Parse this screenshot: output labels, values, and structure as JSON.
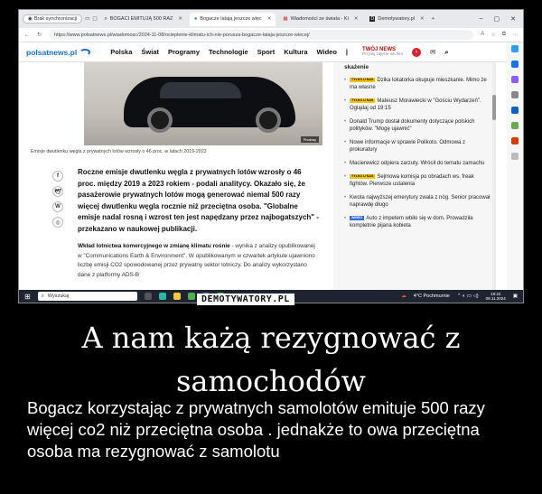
{
  "browser": {
    "sync_label": "Brak synchronizacji",
    "tabs": [
      {
        "label": "BOGACI EMITUJĄ 500 RAZ"
      },
      {
        "label": "Bogacze latają jeszcze więc"
      },
      {
        "label": "Wiadomości ze świata - Ki"
      },
      {
        "label": "Demotywatory.pl"
      }
    ],
    "url": "https://www.polsatnews.pl/wiadomosc/2024-11-08/ocieplenie-klimatu-ich-nie-porusza-bogacze-lataja-jeszcze-wiecej/"
  },
  "site": {
    "logo": "polsatnews.pl",
    "nav": [
      "Polska",
      "Świat",
      "Programy",
      "Technologie",
      "Sport",
      "Kultura",
      "Wideo"
    ],
    "twoj_label": "TWÓJ NEWS",
    "twoj_sub": "Przyślij zdjęcie lub film"
  },
  "article": {
    "photo_credit": "Pixabay",
    "caption": "Emisje dwutlenku węgla z prywatnych lotów wzrosły o 46 proc. w latach 2019-2023",
    "lead": "Roczne emisje dwutlenku węgla z prywatnych lotów wzrosły o 46 proc. między 2019 a 2023 rokiem - podali analitycy. Okazało się, że pasażerowie prywatnych lotów mogą generować niemal 500 razy więcej dwutlenku węgla rocznie niż przeciętna osoba. \"Globalne emisje nadal rosną i wzrost ten jest napędzany przez najbogatszych\" - przekazano w naukowej publikacji.",
    "body_bold": "Wkład lotnictwa komercyjnego w zmianę klimatu rośnie",
    "body_rest": " - wynika z analizy opublikowanej w \"Communications Earth & Environment\". W opublikowanym w czwartek artykule ujawniono liczbę emisji CO2 spowodowanej przez prywatny sektor lotniczy. Do analizy wykorzystano dane z platformy ADS-B"
  },
  "sidebar": {
    "top": "skażenie",
    "news": [
      {
        "tag": "TYLKO U NAS",
        "text": "Dzika lokatorka okupuje mieszkanie. Mimo że ma własne"
      },
      {
        "tag": "TYLKO U NAS",
        "text": "Mateusz Morawiecki w \"Gościu Wydarzeń\". Oglądaj od 19:15"
      },
      {
        "tag": "",
        "text": "Donald Trump dostał dokumenty dotyczące polskich polityków. \"Mogę ujawnić\""
      },
      {
        "tag": "",
        "text": "Nowe informacje w sprawie Polikoto. Odmowa z prokuratury"
      },
      {
        "tag": "",
        "text": "Macierewicz odpiera zarzuty. Wrócił do tematu zamachu"
      },
      {
        "tag": "TYLKO U NAS",
        "text": "Sejmowa komisja po obradach ws. freak fightów. Pierwsze ustalenia"
      },
      {
        "tag": "",
        "text": "Kwota najwyższej emerytury zwala z nóg. Senior pracował naprawdę długo"
      },
      {
        "tag": "WIDEO",
        "text": "Auto z impetem wbiło się w dom. Prowadziła kompletnie pijana kobieta"
      }
    ]
  },
  "taskbar": {
    "search": "Wyszukaj",
    "weather": "4°C  Pochmurnie",
    "time": "18:22",
    "date": "08.11.2024"
  },
  "watermark": "DEMOTYWATORY.PL",
  "poster": {
    "title": "A nam każą rezygnować z samochodów",
    "subtitle": "Bogacz  korzystając z prywatnych samolotów emituje 500 razy więcej co2 niż przeciętna osoba . jednakże to owa przeciętna osoba ma rezygnować z samolotu"
  }
}
